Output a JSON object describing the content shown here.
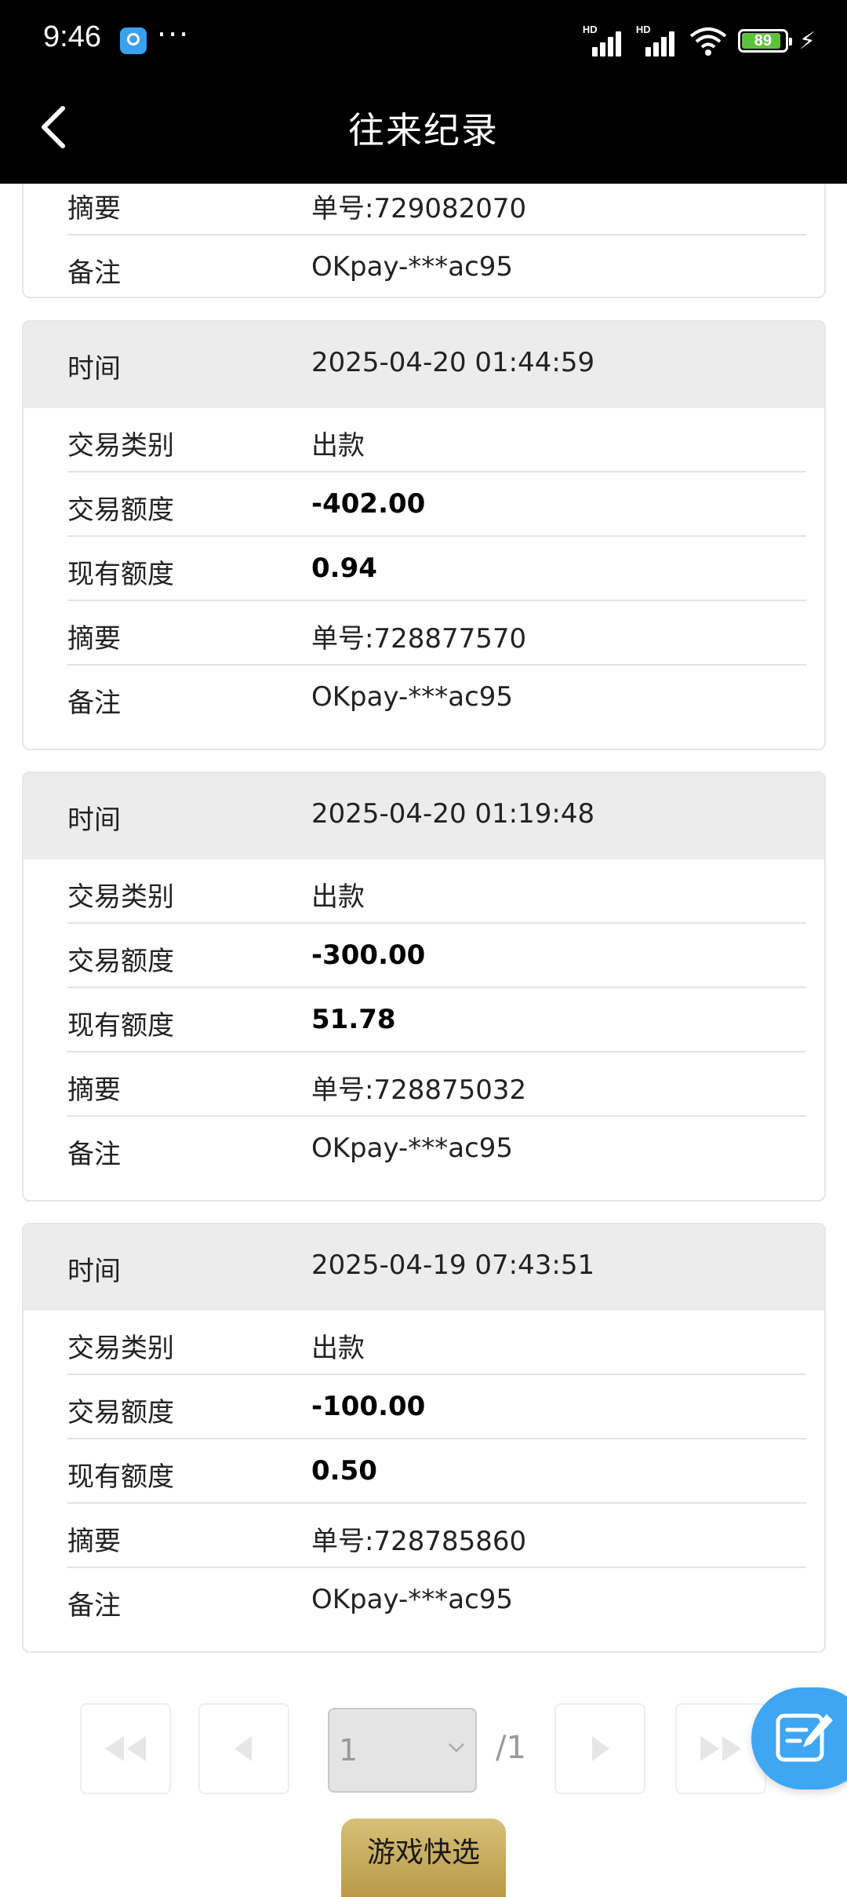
{
  "status_bar": {
    "time": "9:46",
    "more": "···",
    "signal_labels": [
      "HD",
      "HD"
    ],
    "battery": "89"
  },
  "header": {
    "title": "往来纪录"
  },
  "partial_record": {
    "summary_label": "摘要",
    "summary_value": "单号:729082070",
    "note_label": "备注",
    "note_value": "OKpay-***ac95"
  },
  "records": [
    {
      "time_label": "时间",
      "time_value": "2025-04-20 01:44:59",
      "type_label": "交易类别",
      "type_value": "出款",
      "amount_label": "交易额度",
      "amount_value": "-402.00",
      "balance_label": "现有额度",
      "balance_value": "0.94",
      "summary_label": "摘要",
      "summary_value": "单号:728877570",
      "note_label": "备注",
      "note_value": "OKpay-***ac95"
    },
    {
      "time_label": "时间",
      "time_value": "2025-04-20 01:19:48",
      "type_label": "交易类别",
      "type_value": "出款",
      "amount_label": "交易额度",
      "amount_value": "-300.00",
      "balance_label": "现有额度",
      "balance_value": "51.78",
      "summary_label": "摘要",
      "summary_value": "单号:728875032",
      "note_label": "备注",
      "note_value": "OKpay-***ac95"
    },
    {
      "time_label": "时间",
      "time_value": "2025-04-19 07:43:51",
      "type_label": "交易类别",
      "type_value": "出款",
      "amount_label": "交易额度",
      "amount_value": "-100.00",
      "balance_label": "现有额度",
      "balance_value": "0.50",
      "summary_label": "摘要",
      "summary_value": "单号:728785860",
      "note_label": "备注",
      "note_value": "OKpay-***ac95"
    }
  ],
  "pagination": {
    "current_page": "1",
    "total_pages": "/1"
  },
  "quick_button": {
    "label": "游戏快选"
  },
  "colors": {
    "header_bg": "#000000",
    "card_head_bg": "#ececec",
    "fab": "#3ea6f2",
    "quick_button_gold": "#c9ad5e"
  }
}
